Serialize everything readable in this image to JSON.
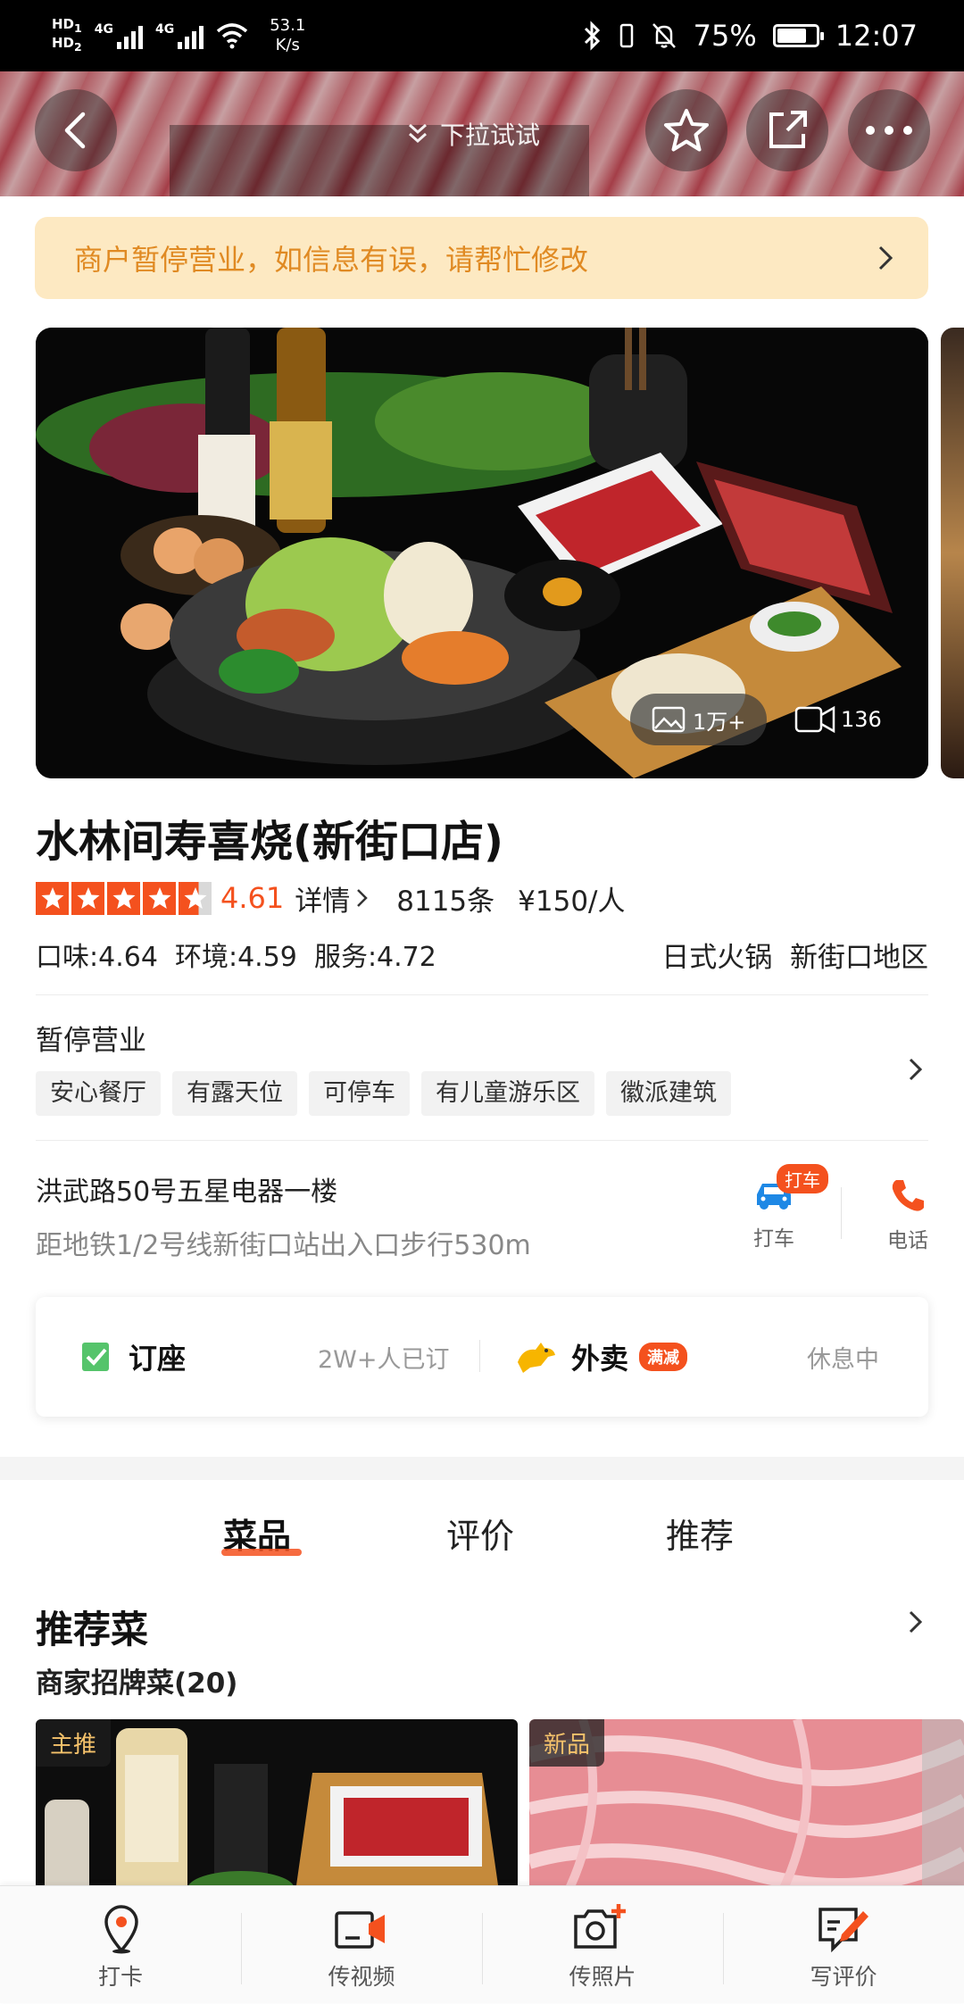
{
  "status_bar": {
    "hd1": "HD",
    "hd1_sub": "1",
    "hd2": "HD",
    "hd2_sub": "2",
    "net1": "4G",
    "net2": "4G",
    "speed_value": "53.1",
    "speed_unit": "K/s",
    "battery_percent": "75%",
    "battery_level": 0.75,
    "time": "12:07"
  },
  "header": {
    "pull_hint": "下拉试试"
  },
  "notice": {
    "text": "商户暂停营业，如信息有误，请帮忙修改"
  },
  "photo": {
    "photo_count": "1万+",
    "video_count": "136"
  },
  "shop": {
    "name": "水林间寿喜烧(新街口店)",
    "star_rating": 4.61,
    "score": "4.61",
    "details_label": "详情",
    "review_count": "8115条",
    "price_per_person": "¥150/人",
    "sub_scores": "口味:4.64  环境:4.59  服务:4.72",
    "categories": "日式火锅  新街口地区"
  },
  "status": {
    "label": "暂停营业",
    "tags": [
      "安心餐厅",
      "有露天位",
      "可停车",
      "有儿童游乐区",
      "徽派建筑"
    ]
  },
  "address": {
    "line": "洪武路50号五星电器一楼",
    "hint": "距地铁1/2号线新街口站出入口步行530m",
    "taxi_badge": "打车",
    "taxi_label": "打车",
    "phone_label": "电话"
  },
  "services": {
    "booking_label": "订座",
    "booking_note": "2W+人已订",
    "delivery_label": "外卖",
    "delivery_badge": "满减",
    "delivery_note": "休息中"
  },
  "tabs": [
    {
      "label": "菜品"
    },
    {
      "label": "评价"
    },
    {
      "label": "推荐"
    }
  ],
  "recommend": {
    "title": "推荐菜",
    "subtitle": "商家招牌菜(20)",
    "dishes": [
      {
        "badge": "主推"
      },
      {
        "badge": "新品"
      }
    ]
  },
  "bottom_bar": {
    "items": [
      {
        "label": "打卡",
        "icon": "location-pin-icon"
      },
      {
        "label": "传视频",
        "icon": "video-upload-icon"
      },
      {
        "label": "传照片",
        "icon": "camera-plus-icon"
      },
      {
        "label": "写评价",
        "icon": "write-review-icon"
      }
    ]
  },
  "colors": {
    "accent": "#f4511e",
    "notice_bg": "#fde9c2",
    "notice_text": "#e08a23",
    "taxi_blue": "#1e88e5"
  }
}
